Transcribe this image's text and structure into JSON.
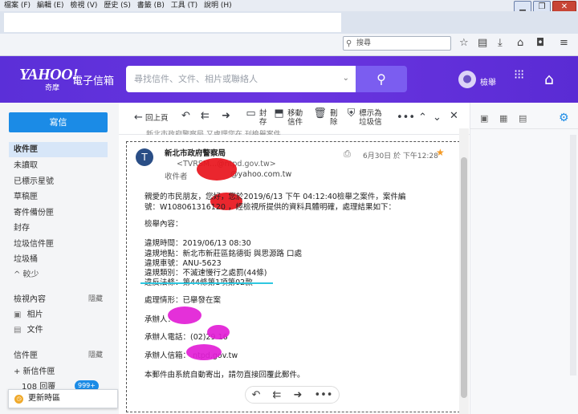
{
  "browser": {
    "menu": [
      "檔案 (F)",
      "編輯 (E)",
      "檢視 (V)",
      "歷史 (S)",
      "書籤 (B)",
      "工具 (T)",
      "說明 (H)"
    ],
    "search_placeholder": "搜尋"
  },
  "header": {
    "logo": "YAHOO!",
    "logo_sub": "奇摩",
    "logo_product": "電子信箱",
    "search_placeholder": "尋找信件、文件、相片或聯絡人",
    "user": "檢舉"
  },
  "sidebar": {
    "compose": "寫信",
    "folders": [
      "收件匣",
      "未讀取",
      "已標示星號",
      "草稿匣",
      "寄件備份匣",
      "封存",
      "垃圾信件匣",
      "垃圾桶"
    ],
    "less": "^ 較少",
    "views_header": "檢視內容",
    "views_hide": "隱藏",
    "views": [
      "相片",
      "文件"
    ],
    "folders_header": "信件匣",
    "folders_hide": "隱藏",
    "new_folder": "+ 新信件匣",
    "archive_item": "108 回覆",
    "archive_badge": "999+",
    "toast": "更新時區"
  },
  "toolbar": {
    "back": "回上頁",
    "archive": "封存",
    "move": "移動信件",
    "delete": "刪除",
    "spam": "標示為垃圾信"
  },
  "message": {
    "prev_subject": "新北市政府警察局 又處理您在 刊檢舉案件",
    "sender_name": "新北市政府警察局",
    "sender_email": "<TVRSM...@ntpd.gov.tw>",
    "recipient_label": "收件者",
    "recipient_email": "@yahoo.com.tw",
    "date": "6月30日 於 下午12:28",
    "body": [
      "親愛的市民朋友，您好，您於2019/6/13 下午 04:12:40檢舉之案件，案件編",
      "號：W108061316120        ，經檢視所提供的資料具體明確，處理結果如下：",
      "檢舉內容：",
      "違規時間：2019/06/13 08:30",
      "違規地點：新北市新莊區銘德街 與思源路 口處",
      "違規車號：ANU-5623",
      "違規類別：不滅速慢行之處罰(44條)",
      "違反法條：第44條第1項第02款",
      "處理情形：已舉發在案",
      "承辦人：",
      "承辦人電話：(02)29        16",
      "承辦人信箱：        ntpd.gov.tw",
      "本郵件由系統自動寄出，請勿直接回覆此郵件。"
    ]
  },
  "colors": {
    "header": "#6a35e0",
    "compose": "#1b8be6",
    "highlight": "#2ec7e0",
    "redact_red": "#e8141c",
    "redact_magenta": "#e21ed6"
  }
}
